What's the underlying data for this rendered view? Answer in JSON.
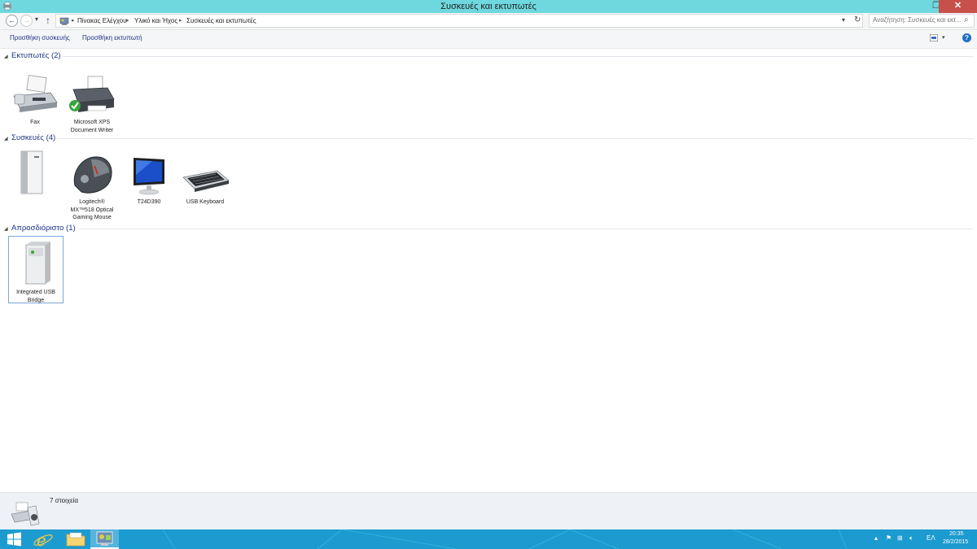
{
  "window": {
    "title": "Συσκευές και εκτυπωτές",
    "controls": {
      "minimize": "–",
      "maximize": "❐",
      "close": "✕"
    }
  },
  "address": {
    "breadcrumbs": [
      "Πίνακας Ελέγχου",
      "Υλικό και Ήχος",
      "Συσκευές και εκτυπωτές"
    ],
    "separator": "▸",
    "search_placeholder": "Αναζήτηση: Συσκευές και εκτ..."
  },
  "commands": {
    "add_device": "Προσθήκη συσκευής",
    "add_printer": "Προσθήκη εκτυπωτή"
  },
  "groups": [
    {
      "label": "Εκτυπωτές (2)",
      "items": [
        {
          "name": "Fax",
          "icon": "fax-icon"
        },
        {
          "name": "Microsoft XPS Document Writer",
          "icon": "printer-icon",
          "default": true
        }
      ]
    },
    {
      "label": "Συσκευές (4)",
      "items": [
        {
          "name": "",
          "icon": "computer-tower-icon"
        },
        {
          "name": "Logitech® MX™518 Optical Gaming Mouse",
          "icon": "mouse-icon"
        },
        {
          "name": "T24D390",
          "icon": "monitor-icon"
        },
        {
          "name": "USB Keyboard",
          "icon": "keyboard-icon"
        }
      ]
    },
    {
      "label": "Απροσδιόριστο (1)",
      "items": [
        {
          "name": "Integrated USB Bridge",
          "icon": "usb-bridge-icon",
          "selected": true
        }
      ]
    }
  ],
  "status": {
    "text": "7 στοιχεία"
  },
  "taskbar": {
    "language": "ΕΛ",
    "time": "20:35",
    "date": "28/2/2015"
  },
  "colors": {
    "titlebar": "#6ed8de",
    "accent": "#1e3287",
    "taskbar": "#1c9bd0",
    "close": "#c7504b"
  }
}
